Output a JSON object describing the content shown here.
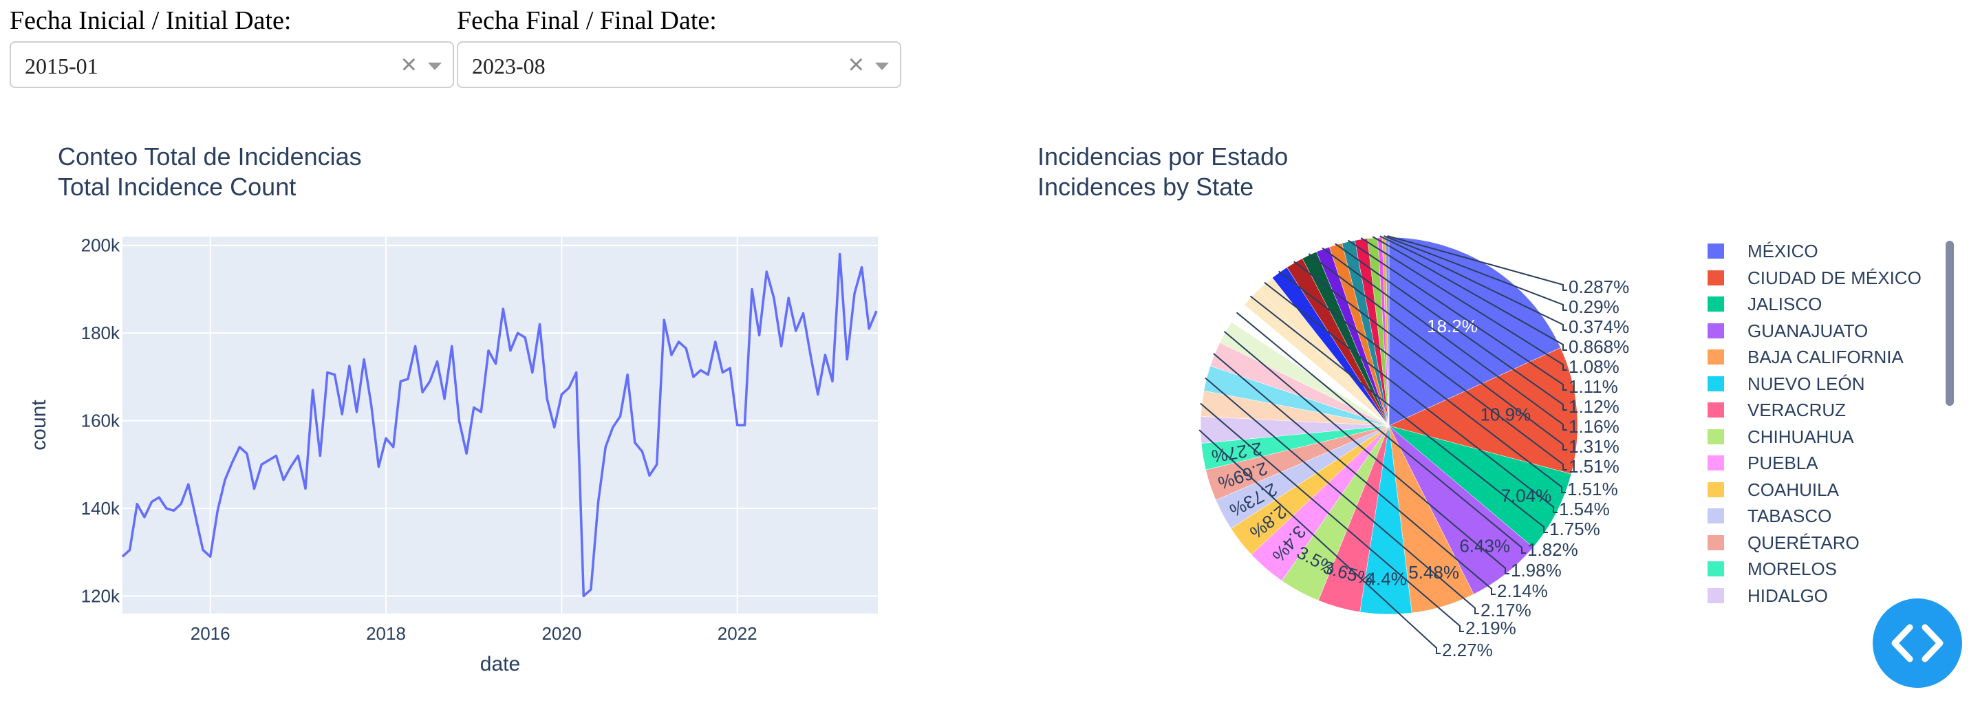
{
  "controls": {
    "start": {
      "label": "Fecha Inicial / Initial Date:",
      "value": "2015-01",
      "clear_icon": "×"
    },
    "end": {
      "label": "Fecha Final / Final Date:",
      "value": "2023-08",
      "clear_icon": "×"
    }
  },
  "line_chart": {
    "title_line1": "Conteo Total de Incidencias",
    "title_line2": "Total Incidence Count"
  },
  "pie_chart": {
    "title_line1": "Incidencias por Estado",
    "title_line2": "Incidences by State"
  },
  "chart_data": [
    {
      "type": "line",
      "title": "Conteo Total de Incidencias / Total Incidence Count",
      "xlabel": "date",
      "ylabel": "count",
      "xlim": [
        2015.0,
        2023.6
      ],
      "ylim": [
        116000,
        202000
      ],
      "x_ticks": [
        2016,
        2018,
        2020,
        2022
      ],
      "x_tick_labels": [
        "2016",
        "2018",
        "2020",
        "2022"
      ],
      "y_ticks": [
        120000,
        140000,
        160000,
        180000,
        200000
      ],
      "y_tick_labels": [
        "120k",
        "140k",
        "160k",
        "180k",
        "200k"
      ],
      "grid": true,
      "color": "#636efa",
      "series": [
        {
          "x_start": 2015.0,
          "x_step_months": 1,
          "values": [
            129000,
            130500,
            141000,
            138000,
            141500,
            142500,
            140000,
            139500,
            141000,
            145500,
            138000,
            130500,
            129000,
            139500,
            146500,
            150500,
            154000,
            152500,
            144500,
            150000,
            151000,
            152000,
            146500,
            149500,
            152000,
            144500,
            167000,
            152000,
            171000,
            170500,
            161500,
            172500,
            162000,
            174000,
            163500,
            149500,
            156000,
            154000,
            169000,
            169500,
            177000,
            166500,
            169000,
            173500,
            165000,
            177000,
            160000,
            152500,
            163000,
            162000,
            176000,
            173000,
            185500,
            176000,
            180000,
            179000,
            171000,
            182000,
            165000,
            158500,
            166000,
            167500,
            171000,
            120000,
            121500,
            141500,
            154000,
            158500,
            161000,
            170500,
            155000,
            153000,
            147500,
            150000,
            183000,
            175000,
            178000,
            176500,
            170000,
            171500,
            170500,
            178000,
            171000,
            172000,
            159000,
            159000,
            190000,
            179500,
            194000,
            188000,
            177000,
            188000,
            180500,
            184500,
            175000,
            166000,
            175000,
            169000,
            198000,
            174000,
            189000,
            195000,
            181000,
            185000
          ]
        }
      ]
    },
    {
      "type": "pie",
      "title": "Incidencias por Estado / Incidences by State",
      "legend_position": "right",
      "slices": [
        {
          "label": "MÉXICO",
          "value": 18.2,
          "text": "18.2%",
          "color": "#636efa"
        },
        {
          "label": "CIUDAD DE MÉXICO",
          "value": 10.9,
          "text": "10.9%",
          "color": "#EF553B"
        },
        {
          "label": "JALISCO",
          "value": 7.04,
          "text": "7.04%",
          "color": "#00cc96"
        },
        {
          "label": "GUANAJUATO",
          "value": 6.43,
          "text": "6.43%",
          "color": "#ab63fa"
        },
        {
          "label": "BAJA CALIFORNIA",
          "value": 5.48,
          "text": "5.48%",
          "color": "#FFA15A"
        },
        {
          "label": "NUEVO LEÓN",
          "value": 4.4,
          "text": "4.4%",
          "color": "#19d3f3"
        },
        {
          "label": "VERACRUZ",
          "value": 3.65,
          "text": "3.65%",
          "color": "#FF6692"
        },
        {
          "label": "CHIHUAHUA",
          "value": 3.5,
          "text": "3.5%",
          "color": "#B6E880"
        },
        {
          "label": "PUEBLA",
          "value": 3.4,
          "text": "3.4%",
          "color": "#FF97FF"
        },
        {
          "label": "COAHUILA",
          "value": 2.8,
          "text": "2.8%",
          "color": "#FECB52"
        },
        {
          "label": "TABASCO",
          "value": 2.73,
          "text": "2.73%",
          "color": "#c6cbf5"
        },
        {
          "label": "QUERÉTARO",
          "value": 2.69,
          "text": "2.69%",
          "color": "#f2a59a"
        },
        {
          "label": "MORELOS",
          "value": 2.27,
          "text": "2.27%",
          "color": "#3ef0bd"
        },
        {
          "label": "HIDALGO",
          "value": 2.27,
          "text": "2.27%",
          "color": "#dccbf5"
        },
        {
          "label": "",
          "value": 2.19,
          "text": "2.19%",
          "color": "#fcd9bd"
        },
        {
          "label": "",
          "value": 2.17,
          "text": "2.17%",
          "color": "#7fe1f5"
        },
        {
          "label": "",
          "value": 2.14,
          "text": "2.14%",
          "color": "#fcc9d6"
        },
        {
          "label": "",
          "value": 1.98,
          "text": "1.98%",
          "color": "#e6f5d4"
        },
        {
          "label": "",
          "value": 1.82,
          "text": "1.82%",
          "color": "#ffffff"
        },
        {
          "label": "",
          "value": 1.75,
          "text": "1.75%",
          "color": "#fde8c4"
        },
        {
          "label": "",
          "value": 1.54,
          "text": "1.54%",
          "color": "#fde8c4"
        },
        {
          "label": "",
          "value": 1.51,
          "text": "1.51%",
          "color": "#1f30ee"
        },
        {
          "label": "",
          "value": 1.51,
          "text": "1.51%",
          "color": "#b22222"
        },
        {
          "label": "",
          "value": 1.31,
          "text": "1.31%",
          "color": "#0a5c3d"
        },
        {
          "label": "",
          "value": 1.16,
          "text": "1.16%",
          "color": "#6f1ee0"
        },
        {
          "label": "",
          "value": 1.12,
          "text": "1.12%",
          "color": "#f07d2c"
        },
        {
          "label": "",
          "value": 1.11,
          "text": "1.11%",
          "color": "#228b9c"
        },
        {
          "label": "",
          "value": 1.08,
          "text": "1.08%",
          "color": "#e8174f"
        },
        {
          "label": "",
          "value": 0.868,
          "text": "0.868%",
          "color": "#8fd14f"
        },
        {
          "label": "",
          "value": 0.374,
          "text": "0.374%",
          "color": "#f254f2"
        },
        {
          "label": "",
          "value": 0.29,
          "text": "0.29%",
          "color": "#e0b24a"
        },
        {
          "label": "",
          "value": 0.287,
          "text": "0.287%",
          "color": "#8f94e8"
        }
      ]
    }
  ],
  "fab": {
    "icon": "code-icon"
  }
}
